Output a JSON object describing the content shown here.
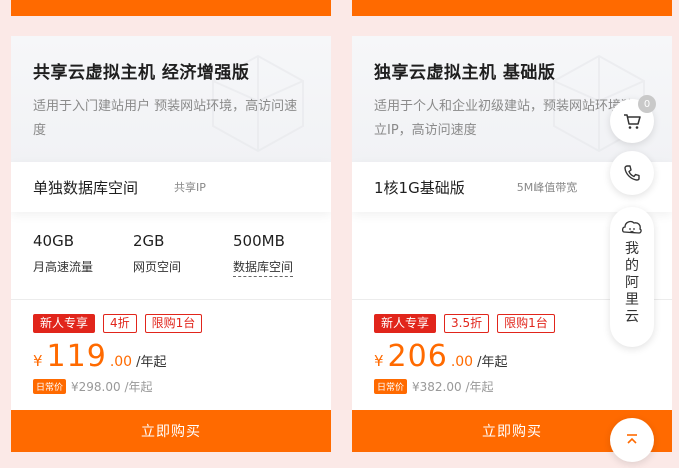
{
  "cards": [
    {
      "title": "共享云虚拟主机 经济增强版",
      "description": "适用于入门建站用户 预装网站环境，高访问速度",
      "spec_main": "单独数据库空间",
      "spec_sub": "共享IP",
      "stats": [
        {
          "value": "40GB",
          "label": "月高速流量"
        },
        {
          "value": "2GB",
          "label": "网页空间"
        },
        {
          "value": "500MB",
          "label": "数据库空间"
        }
      ],
      "tags": [
        "新人专享",
        "4折",
        "限购1台"
      ],
      "price": {
        "currency": "¥",
        "integer": "119",
        "decimal": ".00",
        "unit": "/年起"
      },
      "daily_label": "日常价",
      "original_price": "¥298.00 /年起",
      "buy_label": "立即购买"
    },
    {
      "title": "独享云虚拟主机 基础版",
      "description": "适用于个人和企业初级建站，预装网站环境独立IP，高访问速度",
      "spec_main": "1核1G基础版",
      "spec_sub": "5M峰值带宽",
      "tags": [
        "新人专享",
        "3.5折",
        "限购1台"
      ],
      "price": {
        "currency": "¥",
        "integer": "206",
        "decimal": ".00",
        "unit": "/年起"
      },
      "daily_label": "日常价",
      "original_price": "¥382.00 /年起",
      "buy_label": "立即购买"
    }
  ],
  "sidebar": {
    "cart_badge": "0",
    "me_label": "我的阿里云",
    "icons": [
      "cart-icon",
      "phone-icon",
      "face-icon",
      "back-to-top-icon"
    ]
  },
  "colors": {
    "accent": "#ff6a00",
    "tag_red": "#e1251b",
    "background": "#fbe9e7"
  }
}
